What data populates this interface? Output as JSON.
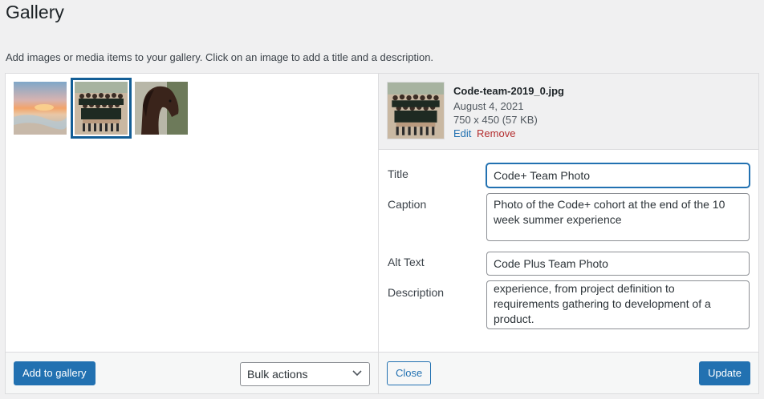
{
  "page": {
    "title": "Gallery",
    "instructions": "Add images or media items to your gallery. Click on an image to add a title and a description."
  },
  "gallery": {
    "thumbnails": [
      {
        "name": "sunset-beach-thumbnail",
        "selected": false
      },
      {
        "name": "code-team-thumbnail",
        "selected": true
      },
      {
        "name": "horse-thumbnail",
        "selected": false
      }
    ],
    "add_button": "Add to gallery",
    "bulk_actions": {
      "selected": "Bulk actions"
    }
  },
  "attachment": {
    "filename": "Code-team-2019_0.jpg",
    "date": "August 4, 2021",
    "dimensions": "750 x 450 (57 KB)",
    "edit_label": "Edit",
    "remove_label": "Remove",
    "fields": {
      "title": {
        "label": "Title",
        "value": "Code+ Team Photo"
      },
      "caption": {
        "label": "Caption",
        "value": "Photo of the Code+ cohort at the end of the 10 week summer experience"
      },
      "alt": {
        "label": "Alt Text",
        "value": "Code Plus Team Photo"
      },
      "description": {
        "label": "Description",
        "value": "experience, from project definition to requirements gathering to development of a product."
      }
    },
    "close_button": "Close",
    "update_button": "Update"
  },
  "colors": {
    "accent": "#2271b1",
    "remove": "#b32d2e",
    "selected_outline": "#135e96"
  }
}
